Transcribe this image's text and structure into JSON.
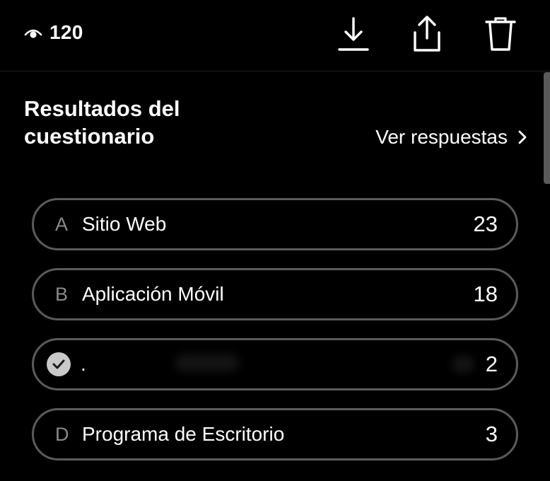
{
  "header": {
    "views_icon": "eye-icon",
    "views_count": "120",
    "actions": [
      {
        "icon": "download-icon"
      },
      {
        "icon": "share-icon"
      },
      {
        "icon": "trash-icon"
      }
    ]
  },
  "quiz": {
    "title": "Resultados del cuestionario",
    "view_answers_label": "Ver respuestas",
    "view_answers_icon": "chevron-right-icon",
    "options": [
      {
        "letter": "A",
        "label": "Sitio Web",
        "count": "23",
        "correct": false
      },
      {
        "letter": "B",
        "label": "Aplicación Móvil",
        "count": "18",
        "correct": false
      },
      {
        "letter": "",
        "label": ".",
        "count": "2",
        "correct": true,
        "icon": "check-circle-icon"
      },
      {
        "letter": "D",
        "label": "Programa de Escritorio",
        "count": "3",
        "correct": false
      }
    ]
  },
  "colors": {
    "background": "#000000",
    "border": "#5b5b5b",
    "muted_text": "#8a8a8a",
    "check_badge": "#c9c9c9"
  }
}
